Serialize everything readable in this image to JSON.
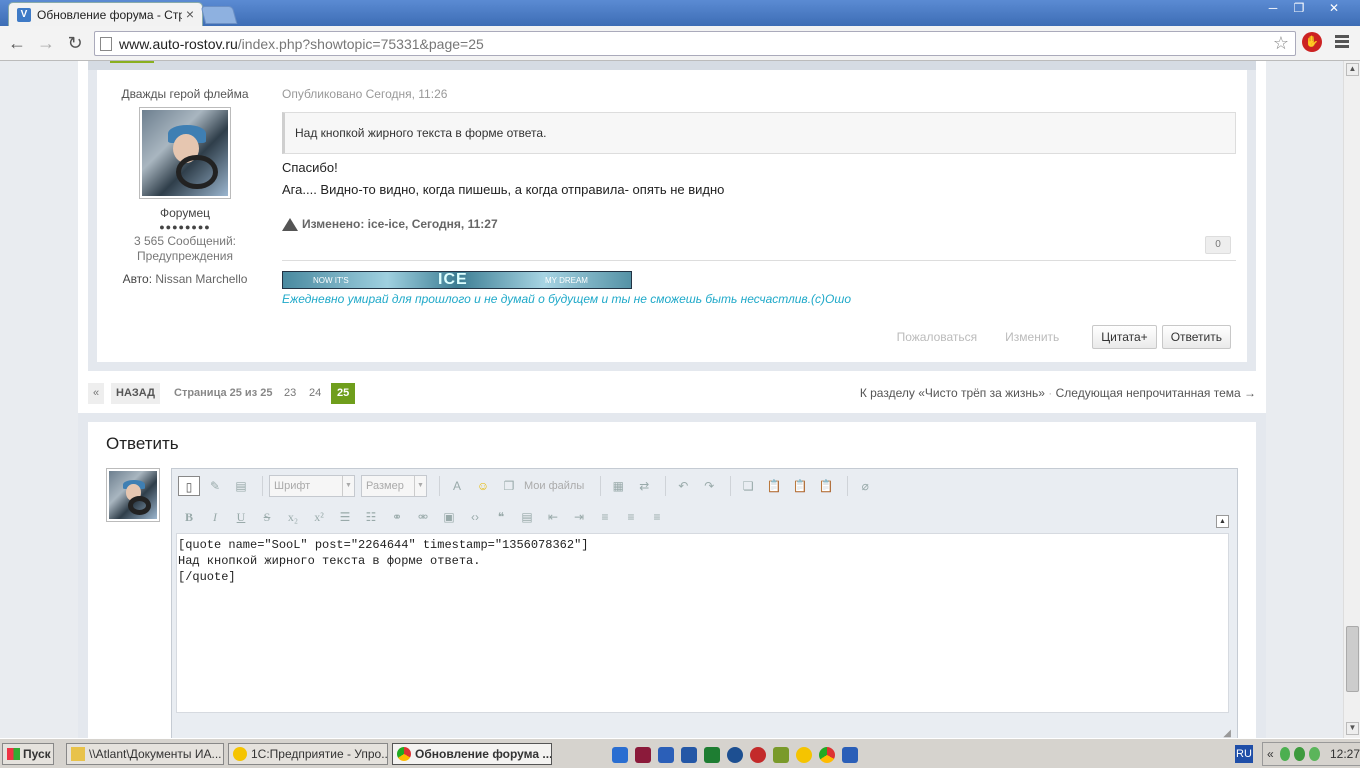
{
  "browser": {
    "tab_title": "Обновление форума - Стра",
    "tab_close": "×",
    "url_host": "www.auto-rostov.ru",
    "url_rest": "/index.php?showtopic=75331&page=25",
    "window_buttons": [
      "─",
      "❐",
      "✕"
    ]
  },
  "post": {
    "author": {
      "rank_title": "Дважды герой флейма",
      "group": "Форумец",
      "pips": "●●●●●●●●",
      "posts": "3 565 Сообщений:",
      "warnings": "Предупреждения",
      "car_label": "Авто:",
      "car_value": "Nissan Marchello"
    },
    "date": "Опубликовано Сегодня, 11:26",
    "quote": "Над кнопкой жирного текста в форме ответа.",
    "lines": [
      "Спасибо!",
      "Ага.... Видно-то видно, когда пишешь, а когда отправила- опять не видно"
    ],
    "edited": "Изменено: ice-ice, Сегодня, 11:27",
    "reputation": "0",
    "signature_banner": {
      "left": "NOW IT'S",
      "center": "ICE",
      "right": "MY DREAM"
    },
    "signature_text": "Ежедневно умирай для прошлого и не думай о будущем и ты не сможешь быть несчастлив.(с)Ошо",
    "actions": {
      "report": "Пожаловаться",
      "edit": "Изменить",
      "quote_plus": "Цитата+",
      "reply": "Ответить"
    }
  },
  "pager": {
    "prev_arrows": "«",
    "back": "НАЗАД",
    "page_info": "Страница 25 из 25",
    "pages": [
      "23",
      "24",
      "25"
    ],
    "to_section": "К разделу «Чисто трёп за жизнь»",
    "dot": "·",
    "next_unread": "Следующая непрочитанная тема →"
  },
  "reply": {
    "title": "Ответить",
    "toolbar": {
      "font_placeholder": "Шрифт",
      "size_placeholder": "Размер",
      "my_files": "Мои файлы"
    },
    "text": "[quote name=\"SooL\" post=\"2264644\" timestamp=\"1356078362\"]\nНад кнопкой жирного текста в форме ответа.\n[/quote]"
  },
  "taskbar": {
    "start": "Пуск",
    "tasks": [
      "\\\\Atlant\\Документы ИА...",
      "1С:Предприятие - Упро...",
      "Обновление форума ..."
    ],
    "lang": "RU",
    "tray_chevron": "«",
    "clock": "12:27"
  },
  "colors": {
    "accent_green": "#6f9e1c",
    "signature_cyan": "#1fa9c9",
    "chrome_blue": "#4a7bc4"
  }
}
